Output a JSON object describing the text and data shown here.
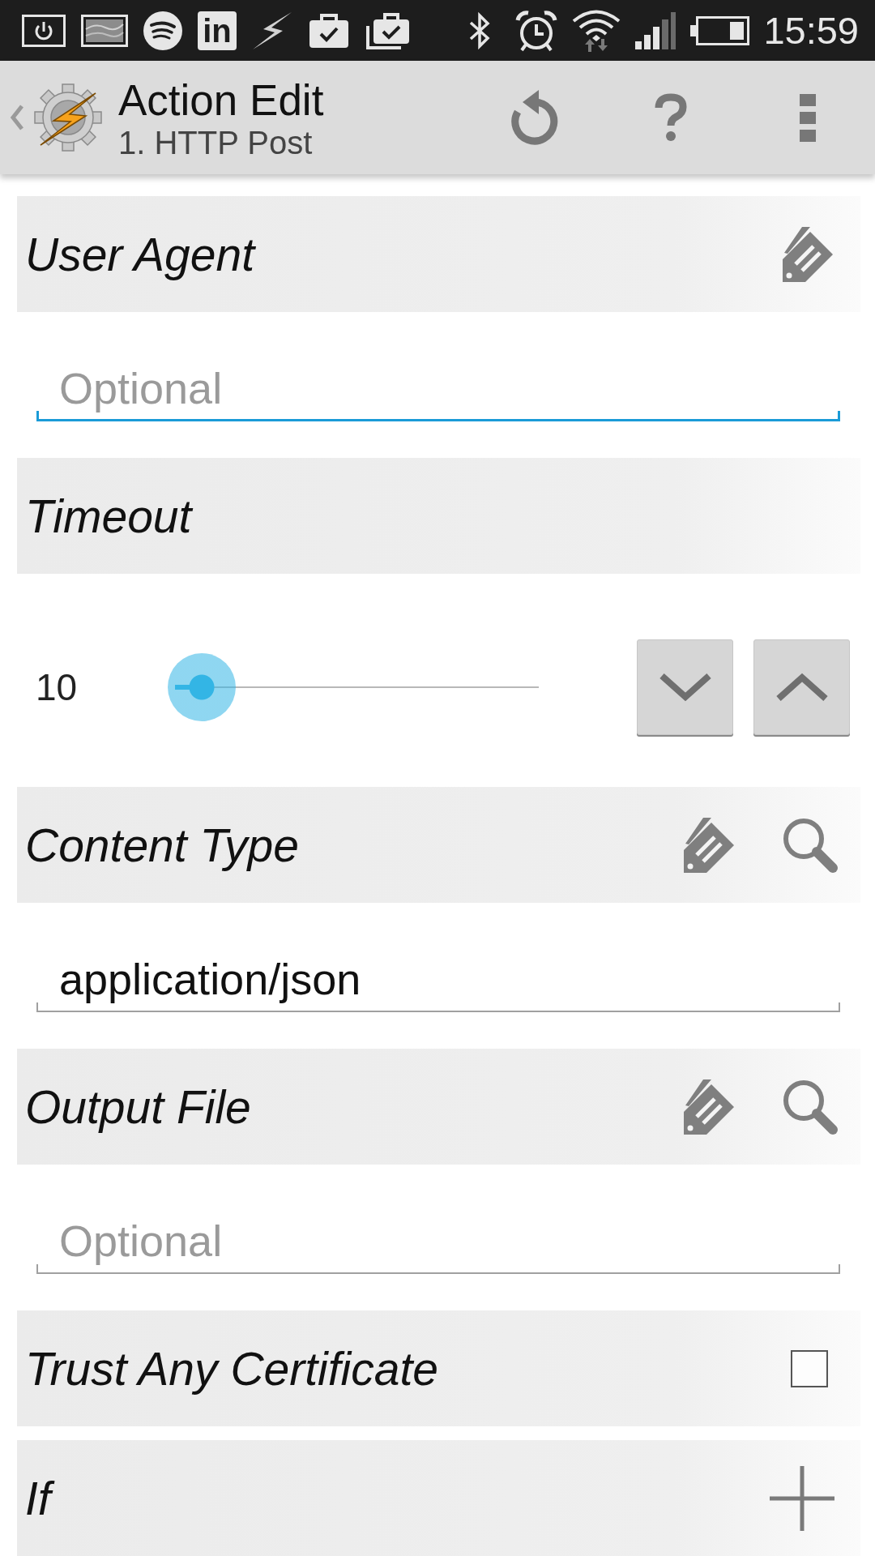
{
  "status_bar": {
    "app_badge": "in",
    "time": "15:59"
  },
  "action_bar": {
    "title": "Action Edit",
    "subtitle": "1. HTTP Post"
  },
  "sections": [
    {
      "kind": "text",
      "label": "User Agent",
      "field": {
        "placeholder": "Optional",
        "focused": true
      }
    },
    {
      "kind": "slider",
      "label": "Timeout",
      "value": "10",
      "level": 0.073
    },
    {
      "kind": "lookup",
      "label": "Content Type",
      "field": {
        "value": "application/json",
        "focused": false
      }
    },
    {
      "kind": "lookup",
      "label": "Output File",
      "field": {
        "placeholder": "Optional",
        "focused": false
      }
    },
    {
      "kind": "checkbox",
      "label": "Trust Any Certificate",
      "checked": false
    },
    {
      "kind": "condition",
      "label": "If"
    }
  ]
}
